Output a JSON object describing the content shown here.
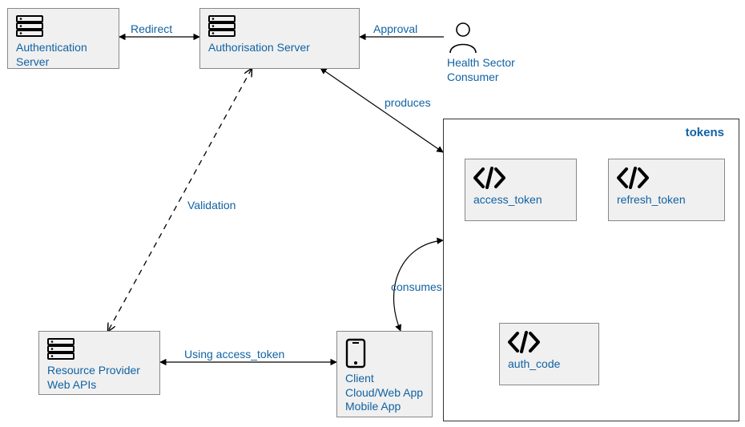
{
  "nodes": {
    "auth_server": {
      "label_line1": " Authentication",
      "label_line2": "Server"
    },
    "authz_server": {
      "label_line1": "Authorisation Server"
    },
    "consumer": {
      "label_line1": "Health Sector",
      "label_line2": "Consumer"
    },
    "resource": {
      "label_line1": " Resource Provider",
      "label_line2": "Web APIs"
    },
    "client": {
      "label_line1": "Client",
      "label_line2": "Cloud/Web App",
      "label_line3": "Mobile App"
    },
    "access_token": {
      "label": "access_token"
    },
    "refresh_token": {
      "label": "refresh_token"
    },
    "auth_code": {
      "label": "auth_code"
    }
  },
  "containers": {
    "tokens": {
      "title": "tokens"
    }
  },
  "edges": {
    "redirect": {
      "label": "Redirect"
    },
    "approval": {
      "label": "Approval"
    },
    "produces": {
      "label": "produces"
    },
    "consumes": {
      "label": "consumes"
    },
    "validation": {
      "label": "Validation"
    },
    "using": {
      "label": "Using access_token"
    }
  }
}
